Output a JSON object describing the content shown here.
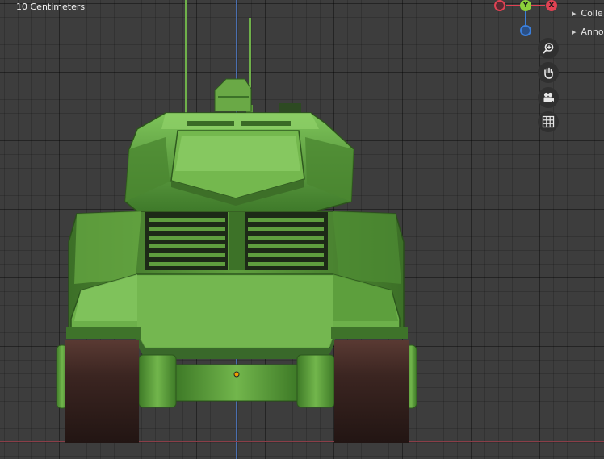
{
  "viewport": {
    "scale_label": "10 Centimeters",
    "colors": {
      "background": "#3d3d3d",
      "axis_z": "#4a6fb0",
      "axis_x": "#8a3e48",
      "model_green": "#5d9a3c",
      "tracks": "#3a2420"
    }
  },
  "gizmo": {
    "y_label": "Y",
    "x_label": "X",
    "colors": {
      "x": "#e04253",
      "y": "#8ccf3b",
      "z": "#3b7fdb"
    }
  },
  "nav": {
    "zoom_icon": "zoom-icon",
    "pan_icon": "hand-icon",
    "camera_icon": "camera-icon",
    "grid_icon": "grid-icon"
  },
  "outliner": {
    "items": [
      {
        "label": "Colle"
      },
      {
        "label": "Anno"
      }
    ]
  }
}
